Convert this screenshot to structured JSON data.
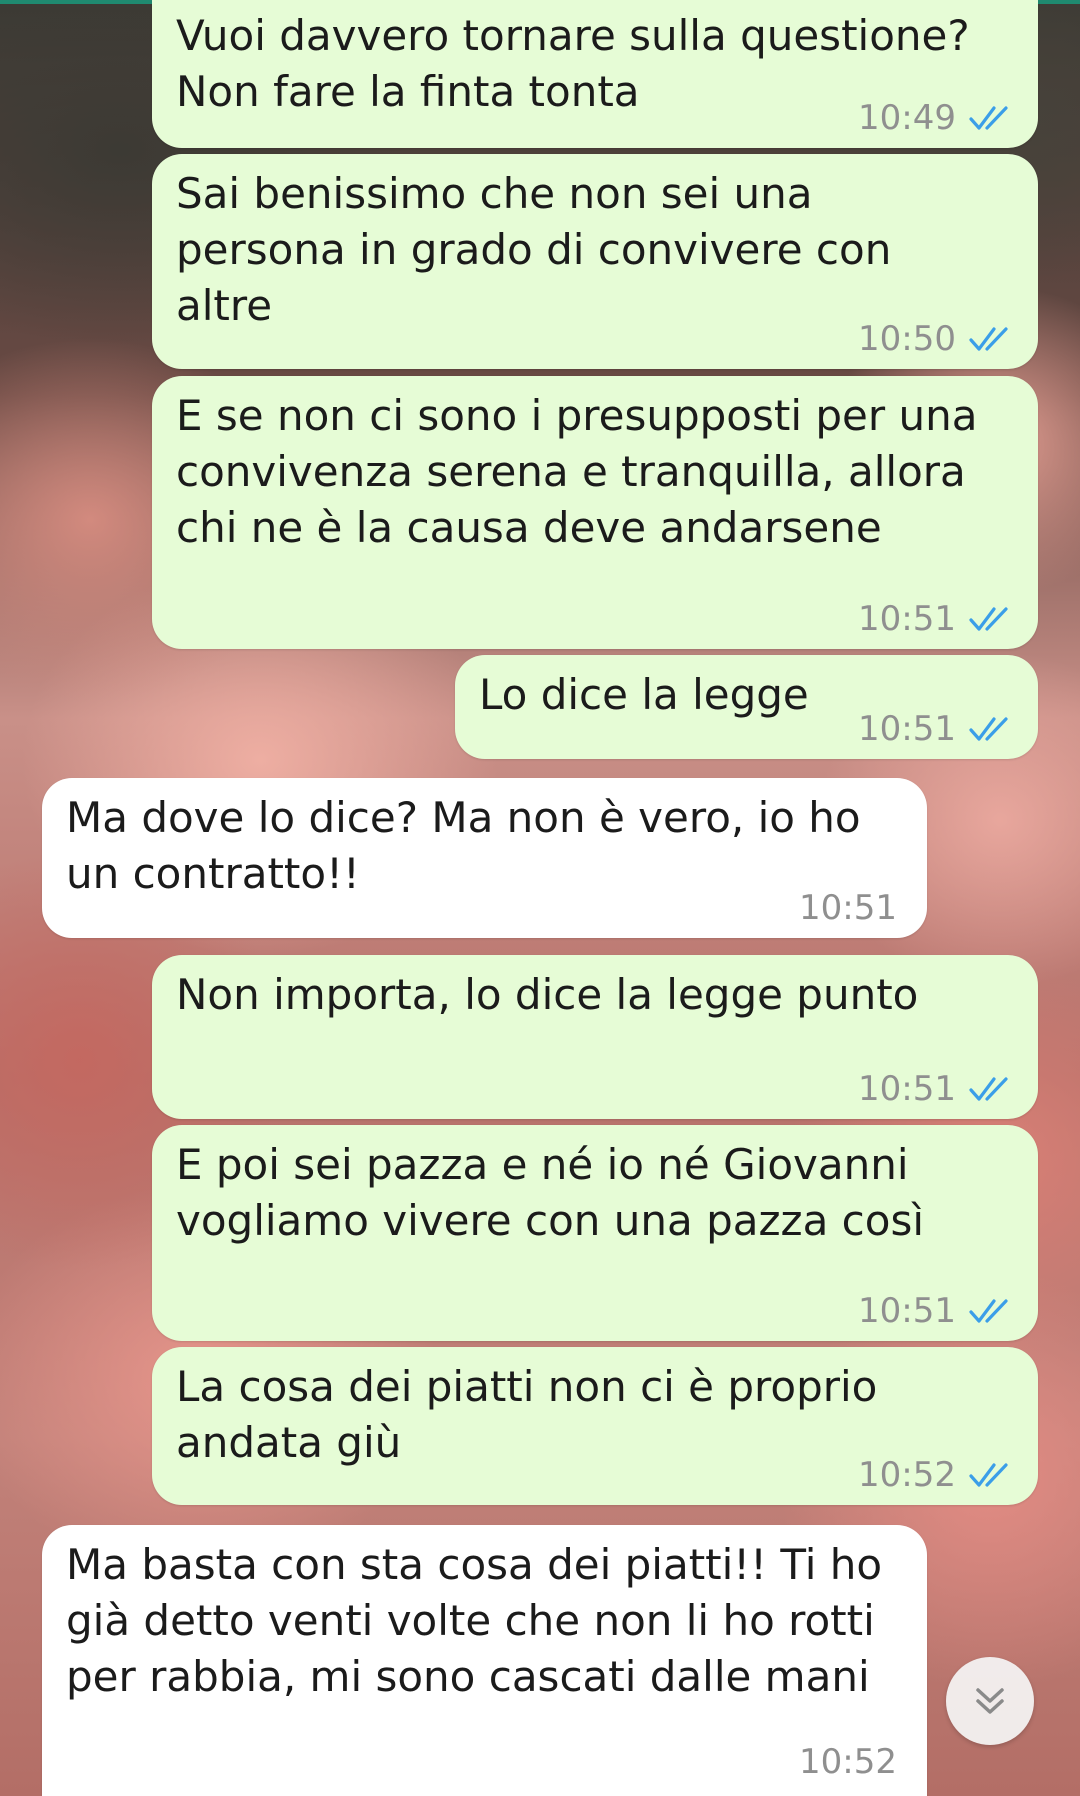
{
  "colors": {
    "outgoing_bubble": "#e6fcd6",
    "incoming_bubble": "#ffffff",
    "read_ticks": "#3b9ee8",
    "timestamp": "#8f8f8f"
  },
  "messages": [
    {
      "direction": "outgoing",
      "text": "Vuoi davvero tornare sulla questione?\nNon fare la finta tonta",
      "time": "10:49",
      "status_icon": "double-check-read-icon"
    },
    {
      "direction": "outgoing",
      "text": "Sai benissimo che non sei una\npersona in grado di convivere con\naltre",
      "time": "10:50",
      "status_icon": "double-check-read-icon"
    },
    {
      "direction": "outgoing",
      "text": "E se non ci sono i presupposti per una\nconvivenza serena e tranquilla, allora\nchi ne è la causa deve andarsene",
      "time": "10:51",
      "status_icon": "double-check-read-icon"
    },
    {
      "direction": "outgoing",
      "text": "Lo dice la legge",
      "time": "10:51",
      "status_icon": "double-check-read-icon"
    },
    {
      "direction": "incoming",
      "text": "Ma dove lo dice? Ma non è vero, io ho\nun contratto!!",
      "time": "10:51"
    },
    {
      "direction": "outgoing",
      "text": "Non importa, lo dice la legge punto",
      "time": "10:51",
      "status_icon": "double-check-read-icon"
    },
    {
      "direction": "outgoing",
      "text": "E poi sei pazza e né io né Giovanni\nvogliamo vivere con una pazza così",
      "time": "10:51",
      "status_icon": "double-check-read-icon"
    },
    {
      "direction": "outgoing",
      "text": "La cosa dei piatti non ci è proprio\nandata giù",
      "time": "10:52",
      "status_icon": "double-check-read-icon"
    },
    {
      "direction": "incoming",
      "text": "Ma basta con sta cosa dei piatti!! Ti ho\ngià detto venti volte che non li ho rotti\nper rabbia, mi sono cascati dalle mani",
      "time": "10:52"
    }
  ],
  "scroll_to_bottom_icon": "double-chevron-down-icon"
}
